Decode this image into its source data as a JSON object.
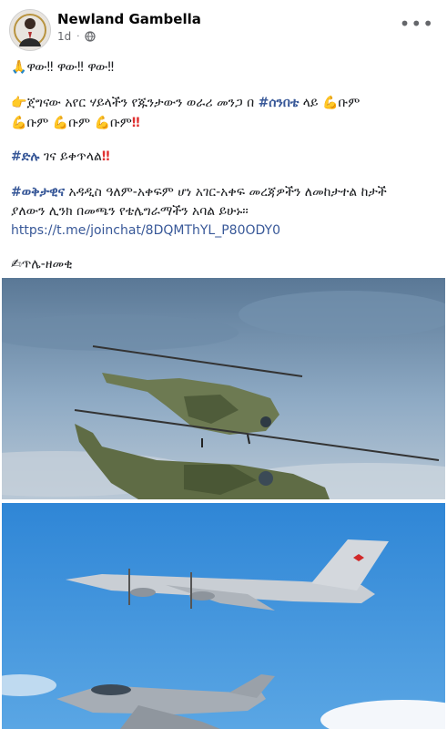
{
  "post": {
    "author": "Newland Gambella",
    "time": "1d",
    "separator": "·",
    "more_icon": "more-horizontal-icon",
    "privacy_icon": "globe-icon",
    "lines": {
      "l1": {
        "text": "ዋው‼ ዋው‼ ዋው‼",
        "prefix_emoji": "🙏"
      },
      "l2a": {
        "pre": "ጀግናው አየር ሃይላችን የጁንታውን ወራሪ መንጋ በ ",
        "tag": "#ሰንበቴ",
        "post": " ላይ ",
        "word": "ቡም",
        "emoji_hand": "👉",
        "emoji_muscle": "💪"
      },
      "l3": {
        "w1": "ቡም",
        "w2": "ቡም",
        "w3": "ቡም",
        "suffix": "‼"
      },
      "l4": {
        "tag": "#ድሉ",
        "text": " ገና ይቀጥላል",
        "suffix": "‼"
      },
      "l5": {
        "tag": "#ወቅታዊና",
        "text": " አዳዲስ ዓለም-አቀፍም ሆነ አገር-አቀፍ መረጃዎችን ለመከታተል ከታች"
      },
      "l6": {
        "text": "ያለውን ሊንክ በመጫን የቴሌግራማችን አባል ይሁኑ።"
      },
      "l7": {
        "link": "https://t.me/joinchat/8DQMThYL_P80ODY0"
      },
      "l8": {
        "emoji": "✍",
        "text": "ጥሌ-ዘመቂ"
      }
    }
  },
  "colors": {
    "link": "#385898",
    "alert": "#e03131",
    "sky_top": "#6c8aa8",
    "sky_blue": "#3d8fd8"
  },
  "images": [
    {
      "name": "helicopters-photo"
    },
    {
      "name": "aircraft-photo"
    }
  ]
}
